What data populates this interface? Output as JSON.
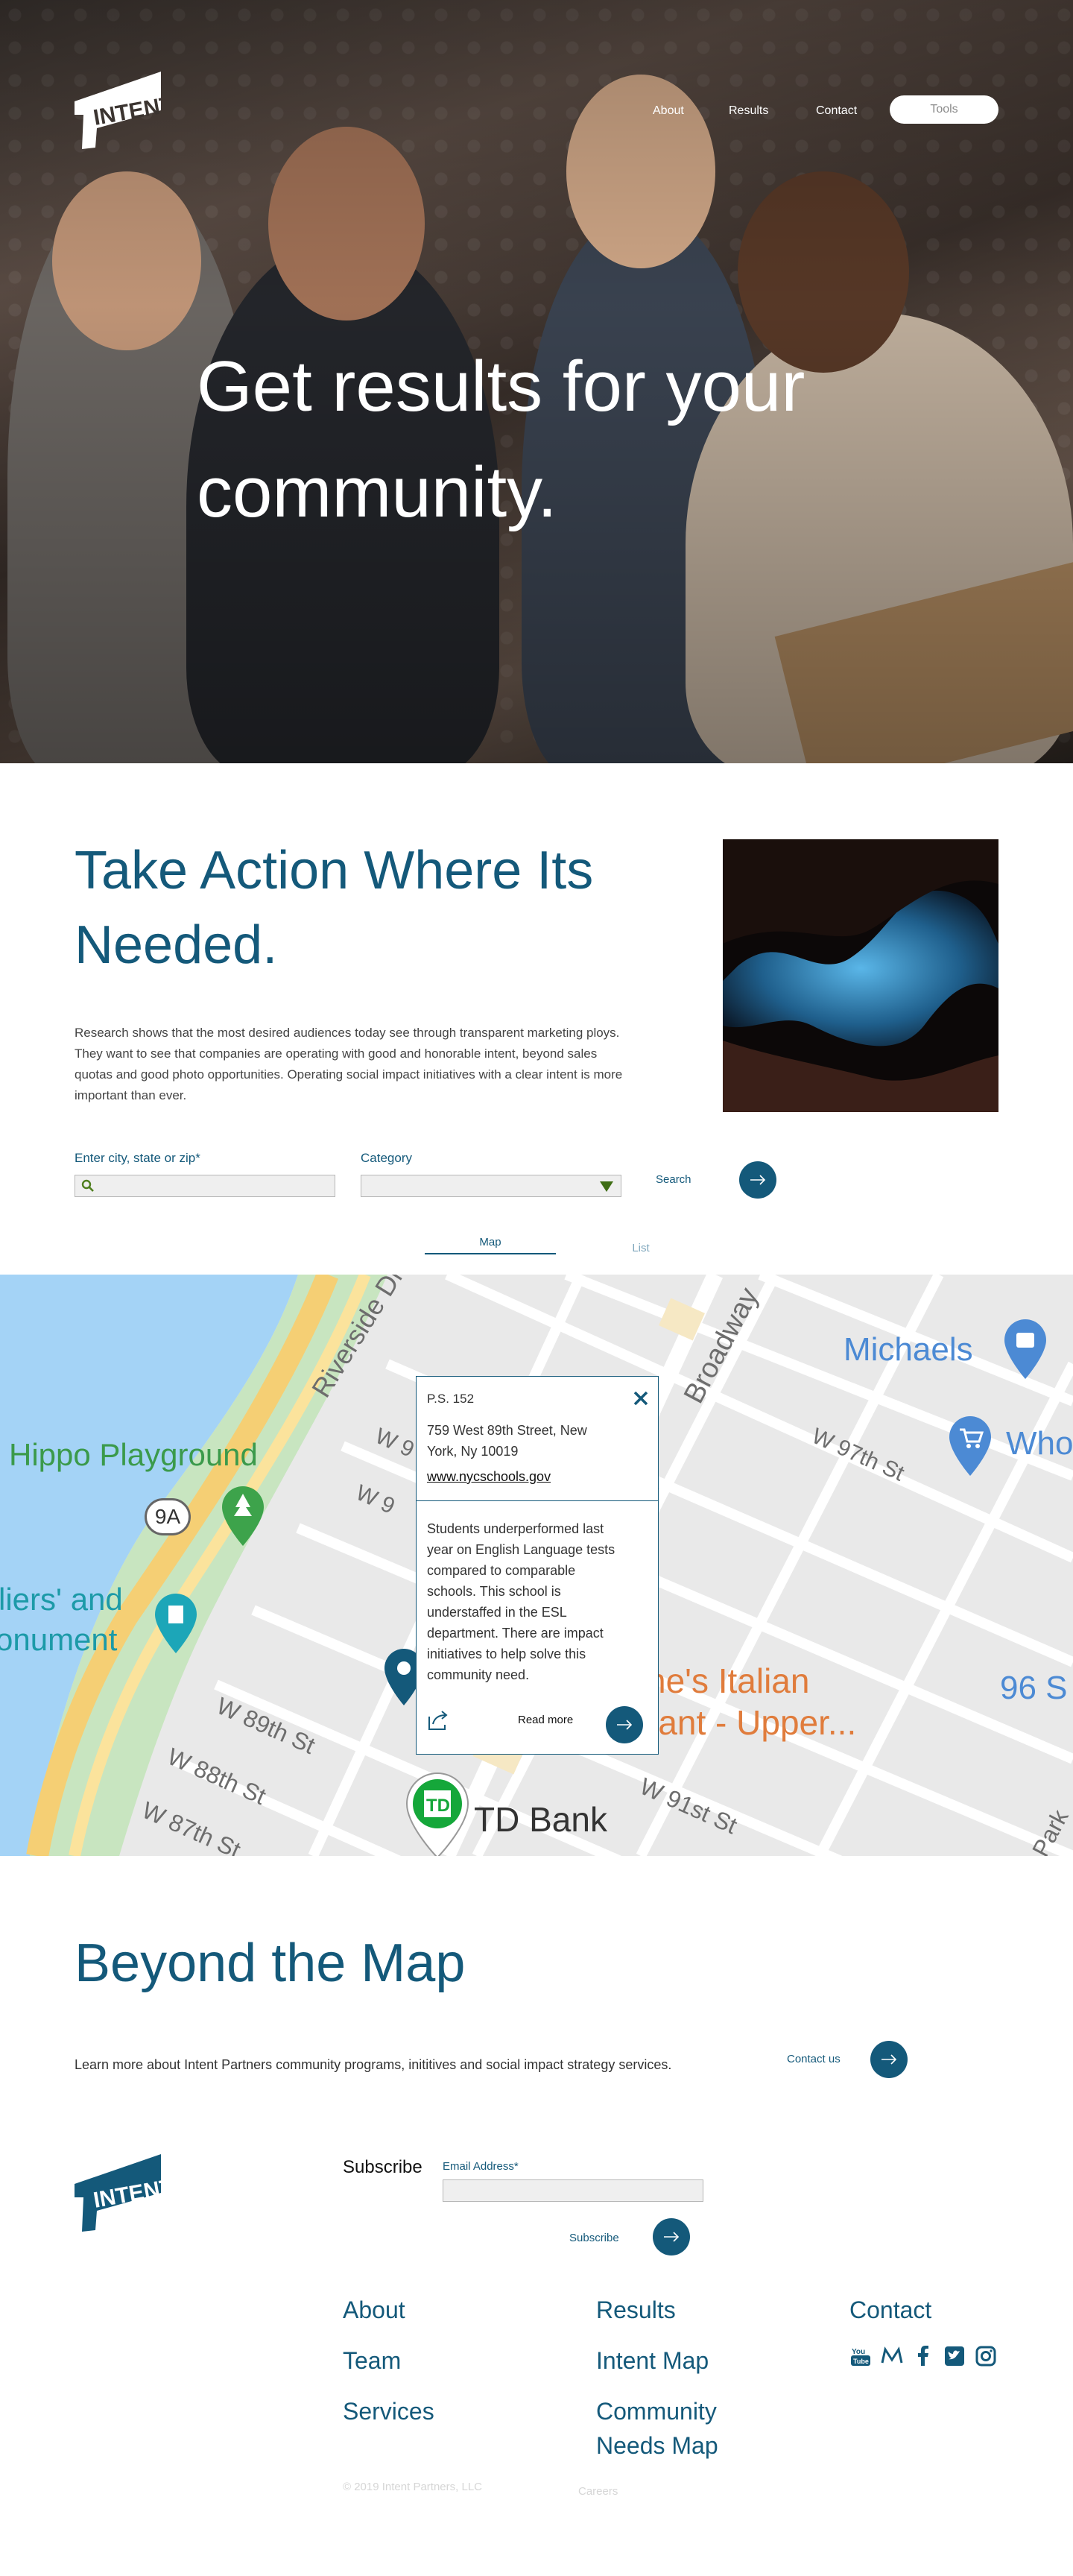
{
  "brand": {
    "logo_text": "INTENT",
    "color": "#14597a"
  },
  "nav": {
    "items": [
      {
        "label": "About"
      },
      {
        "label": "Results"
      },
      {
        "label": "Contact"
      }
    ],
    "tools_label": "Tools"
  },
  "hero": {
    "title": "Get results for your community."
  },
  "take_action": {
    "title": "Take Action Where Its Needed.",
    "body": "Research shows that the most desired audiences today see through transparent marketing ploys. They want to see that companies are operating with good and honorable intent, beyond sales quotas and good photo opportunities. Operating social impact initiatives with a clear intent is more important than ever."
  },
  "search_form": {
    "location_label": "Enter city, state or zip*",
    "location_value": "",
    "category_label": "Category",
    "category_value": "",
    "search_label": "Search"
  },
  "view_tabs": {
    "map": "Map",
    "list": "List"
  },
  "map": {
    "labels": {
      "hippo": "Hippo Playground",
      "soldiers": "liers' and",
      "monument": "onument",
      "riverside": "Riverside Dr",
      "broadway": "Broadway",
      "michaels": "Michaels",
      "who": "Who",
      "w97": "W 97th St",
      "w89": "W 89th St",
      "w88": "W 88th St",
      "w87": "W 87th St",
      "w91": "W 91st St",
      "route": "9A",
      "italian1": "ne's Italian",
      "italian2": "rant - Upper...",
      "ninety_six": "96 S",
      "tdbank": "TD Bank",
      "park": "Park",
      "w9a": "W 9",
      "w9b": "W 9"
    },
    "popup": {
      "name": "P.S. 152",
      "address": "759 West 89th Street, New York, Ny 10019",
      "link": "www.nycschools.gov",
      "description": "Students underperformed last year on English Language tests compared to comparable schools. This school is understaffed in the ESL department. There are impact initiatives to help solve this community need.",
      "read_more": "Read more"
    }
  },
  "beyond": {
    "title": "Beyond the Map",
    "body": "Learn more about Intent Partners community programs, inititives and social impact strategy services.",
    "contact_label": "Contact us"
  },
  "footer": {
    "subscribe_title": "Subscribe",
    "email_label": "Email Address*",
    "email_value": "",
    "subscribe_button": "Subscribe",
    "col1": [
      "About",
      "Team",
      "Services"
    ],
    "col2": [
      "Results",
      "Intent Map",
      "Community",
      "Needs Map"
    ],
    "col3_title": "Contact",
    "copyright": "© 2019 Intent Partners, LLC",
    "careers": "Careers",
    "social_icons": [
      "youtube-icon",
      "medium-icon",
      "facebook-icon",
      "twitter-icon",
      "instagram-icon"
    ]
  }
}
